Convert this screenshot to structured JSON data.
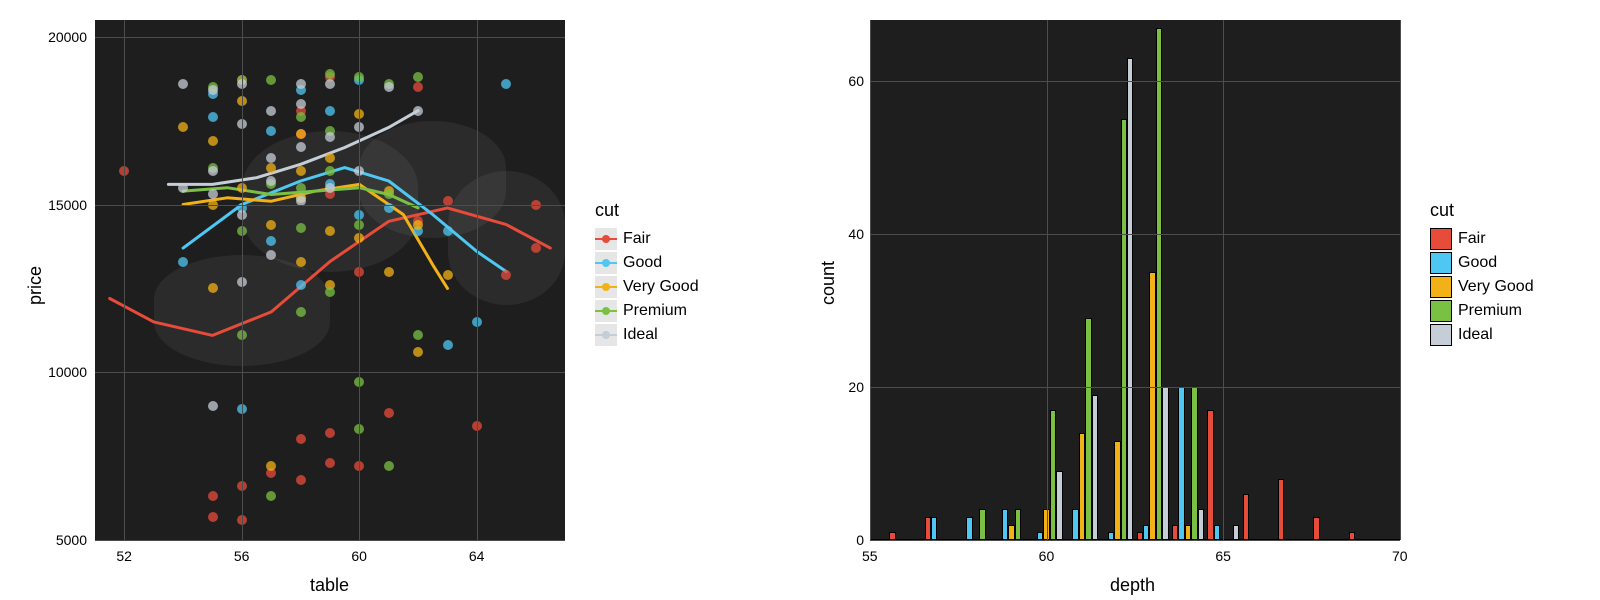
{
  "colors": {
    "Fair": "#e74b3a",
    "Good": "#4fc7f3",
    "Very Good": "#f2b116",
    "Premium": "#7ac143",
    "Ideal": "#c5ced6"
  },
  "legend": {
    "title": "cut",
    "items": [
      "Fair",
      "Good",
      "Very Good",
      "Premium",
      "Ideal"
    ]
  },
  "chart_data": [
    {
      "type": "scatter",
      "title": "",
      "xlabel": "table",
      "ylabel": "price",
      "xlim": [
        51,
        67
      ],
      "ylim": [
        5000,
        20500
      ],
      "xticks": [
        52,
        56,
        60,
        64
      ],
      "yticks": [
        5000,
        10000,
        15000,
        20000
      ],
      "series": [
        {
          "name": "Fair",
          "points": [
            [
              52,
              16000
            ],
            [
              55,
              5700
            ],
            [
              55,
              6300
            ],
            [
              56,
              6600
            ],
            [
              56,
              5600
            ],
            [
              56,
              18700
            ],
            [
              57,
              7000
            ],
            [
              58,
              6800
            ],
            [
              58,
              17100
            ],
            [
              58,
              8000
            ],
            [
              59,
              8200
            ],
            [
              59,
              7300
            ],
            [
              59,
              18800
            ],
            [
              60,
              7200
            ],
            [
              61,
              8800
            ],
            [
              62,
              18500
            ],
            [
              64,
              8400
            ],
            [
              66,
              15000
            ],
            [
              66,
              13700
            ],
            [
              65,
              12900
            ],
            [
              62,
              14500
            ],
            [
              63,
              15100
            ],
            [
              58,
              17800
            ],
            [
              60,
              13000
            ],
            [
              59,
              15300
            ]
          ]
        },
        {
          "name": "Good",
          "points": [
            [
              54,
              13300
            ],
            [
              55,
              18300
            ],
            [
              56,
              8900
            ],
            [
              56,
              14900
            ],
            [
              57,
              13900
            ],
            [
              58,
              15200
            ],
            [
              58,
              18400
            ],
            [
              59,
              17800
            ],
            [
              59,
              15600
            ],
            [
              60,
              14700
            ],
            [
              61,
              14900
            ],
            [
              62,
              14200
            ],
            [
              63,
              10800
            ],
            [
              64,
              11500
            ],
            [
              65,
              18600
            ],
            [
              57,
              17200
            ],
            [
              58,
              12600
            ],
            [
              60,
              18700
            ],
            [
              55,
              17600
            ],
            [
              63,
              14200
            ]
          ]
        },
        {
          "name": "Very Good",
          "points": [
            [
              54,
              17300
            ],
            [
              55,
              15000
            ],
            [
              55,
              16900
            ],
            [
              56,
              15500
            ],
            [
              56,
              18100
            ],
            [
              57,
              16100
            ],
            [
              57,
              14400
            ],
            [
              58,
              15200
            ],
            [
              58,
              17100
            ],
            [
              58,
              16000
            ],
            [
              59,
              16400
            ],
            [
              59,
              14200
            ],
            [
              59,
              12600
            ],
            [
              60,
              14000
            ],
            [
              60,
              17700
            ],
            [
              61,
              15400
            ],
            [
              61,
              13000
            ],
            [
              62,
              10600
            ],
            [
              62,
              14400
            ],
            [
              63,
              12900
            ],
            [
              57,
              7200
            ],
            [
              55,
              12500
            ],
            [
              58,
              13300
            ]
          ]
        },
        {
          "name": "Premium",
          "points": [
            [
              55,
              18500
            ],
            [
              56,
              18700
            ],
            [
              56,
              11100
            ],
            [
              57,
              18700
            ],
            [
              57,
              15600
            ],
            [
              58,
              17600
            ],
            [
              58,
              15500
            ],
            [
              58,
              14300
            ],
            [
              59,
              17200
            ],
            [
              59,
              18900
            ],
            [
              59,
              12400
            ],
            [
              60,
              18800
            ],
            [
              60,
              14400
            ],
            [
              60,
              9700
            ],
            [
              61,
              18600
            ],
            [
              61,
              15300
            ],
            [
              61,
              7200
            ],
            [
              62,
              18800
            ],
            [
              62,
              11100
            ],
            [
              60,
              8300
            ],
            [
              57,
              6300
            ],
            [
              55,
              16100
            ],
            [
              56,
              14200
            ],
            [
              58,
              11800
            ],
            [
              59,
              16000
            ]
          ]
        },
        {
          "name": "Ideal",
          "points": [
            [
              54,
              15500
            ],
            [
              54,
              18600
            ],
            [
              55,
              18400
            ],
            [
              55,
              16000
            ],
            [
              55,
              9000
            ],
            [
              55,
              15300
            ],
            [
              56,
              18600
            ],
            [
              56,
              17400
            ],
            [
              56,
              14700
            ],
            [
              56,
              12700
            ],
            [
              57,
              17800
            ],
            [
              57,
              16400
            ],
            [
              57,
              15700
            ],
            [
              57,
              13500
            ],
            [
              58,
              18600
            ],
            [
              58,
              18000
            ],
            [
              58,
              16700
            ],
            [
              58,
              15100
            ],
            [
              59,
              18600
            ],
            [
              59,
              17000
            ],
            [
              59,
              15500
            ],
            [
              60,
              17300
            ],
            [
              60,
              16000
            ],
            [
              61,
              18500
            ],
            [
              62,
              17800
            ]
          ]
        }
      ],
      "smooth": [
        {
          "name": "Fair",
          "points": [
            [
              51.5,
              12200
            ],
            [
              53,
              11500
            ],
            [
              55,
              11100
            ],
            [
              57,
              11800
            ],
            [
              59,
              13300
            ],
            [
              61,
              14500
            ],
            [
              63,
              14900
            ],
            [
              65,
              14400
            ],
            [
              66.5,
              13700
            ]
          ]
        },
        {
          "name": "Good",
          "points": [
            [
              54,
              13700
            ],
            [
              56,
              15000
            ],
            [
              58,
              15700
            ],
            [
              59.5,
              16100
            ],
            [
              61,
              15700
            ],
            [
              62.5,
              14700
            ],
            [
              64,
              13600
            ],
            [
              65,
              13000
            ]
          ]
        },
        {
          "name": "Very Good",
          "points": [
            [
              54,
              15000
            ],
            [
              55.5,
              15200
            ],
            [
              57,
              15100
            ],
            [
              58.5,
              15400
            ],
            [
              60,
              15600
            ],
            [
              61.5,
              14700
            ],
            [
              62.5,
              13200
            ],
            [
              63,
              12500
            ]
          ]
        },
        {
          "name": "Premium",
          "points": [
            [
              54,
              15400
            ],
            [
              55.5,
              15500
            ],
            [
              57,
              15300
            ],
            [
              58.5,
              15400
            ],
            [
              60,
              15500
            ],
            [
              61,
              15300
            ],
            [
              62,
              14900
            ]
          ]
        },
        {
          "name": "Ideal",
          "points": [
            [
              53.5,
              15600
            ],
            [
              55,
              15600
            ],
            [
              56.5,
              15800
            ],
            [
              58,
              16200
            ],
            [
              59.5,
              16700
            ],
            [
              61,
              17300
            ],
            [
              62,
              17800
            ]
          ]
        }
      ]
    },
    {
      "type": "bar",
      "title": "",
      "xlabel": "depth",
      "ylabel": "count",
      "xlim": [
        55,
        70
      ],
      "ylim": [
        0,
        68
      ],
      "xticks": [
        55,
        60,
        65,
        70
      ],
      "yticks": [
        0,
        20,
        40,
        60
      ],
      "categories": [
        56,
        57,
        58,
        59,
        60,
        61,
        62,
        63,
        64,
        65,
        66,
        67,
        68,
        69
      ],
      "series": [
        {
          "name": "Fair",
          "values": [
            1,
            3,
            0,
            0,
            0,
            0,
            0,
            1,
            2,
            17,
            6,
            8,
            3,
            1
          ]
        },
        {
          "name": "Good",
          "values": [
            0,
            3,
            3,
            4,
            1,
            4,
            1,
            2,
            20,
            2,
            0,
            0,
            0,
            0
          ]
        },
        {
          "name": "Very Good",
          "values": [
            0,
            0,
            0,
            2,
            4,
            14,
            13,
            35,
            2,
            0,
            0,
            0,
            0,
            0
          ]
        },
        {
          "name": "Premium",
          "values": [
            0,
            0,
            4,
            4,
            17,
            29,
            55,
            67,
            20,
            0,
            0,
            0,
            0,
            0
          ]
        },
        {
          "name": "Ideal",
          "values": [
            0,
            0,
            0,
            0,
            9,
            19,
            63,
            20,
            4,
            2,
            0,
            0,
            0,
            0
          ]
        }
      ]
    }
  ]
}
